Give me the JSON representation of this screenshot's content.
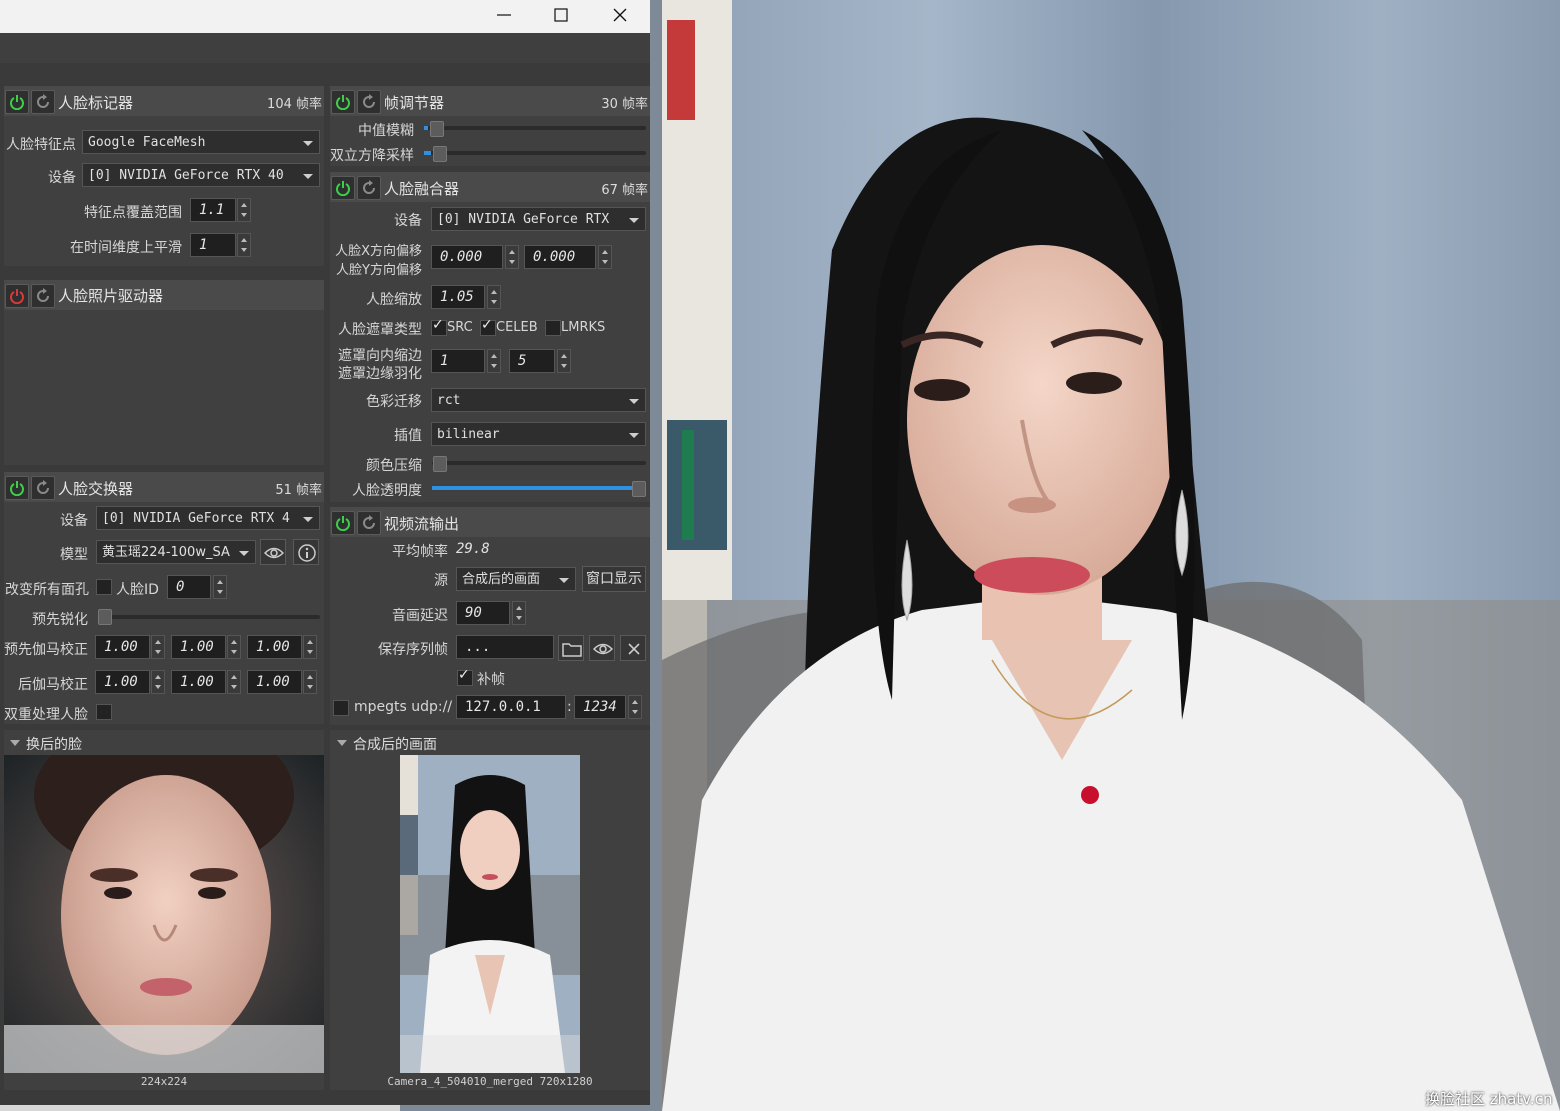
{
  "window": {
    "minimize_icon": "minimize-icon",
    "maximize_icon": "maximize-icon",
    "close_icon": "close-icon"
  },
  "landmarker": {
    "title": "人脸标记器",
    "fps": "104 帧率",
    "landmarks_label": "人脸特征点",
    "landmarks_value": "Google FaceMesh",
    "device_label": "设备",
    "device_value": "[0] NVIDIA GeForce RTX 40",
    "range_label": "特征点覆盖范围",
    "range_value": "1.1",
    "smooth_label": "在时间维度上平滑",
    "smooth_value": "1"
  },
  "animator": {
    "title": "人脸照片驱动器"
  },
  "swapper": {
    "title": "人脸交换器",
    "fps": "51 帧率",
    "device_label": "设备",
    "device_value": "[0] NVIDIA GeForce RTX 4",
    "model_label": "模型",
    "model_value": "黄玉瑶224-100w_SA",
    "swap_all_label": "改变所有面孔",
    "face_id_label": "人脸ID",
    "face_id_value": "0",
    "presharpen_label": "预先锐化",
    "pregamma_label": "预先伽马校正",
    "pregamma_values": [
      "1.00",
      "1.00",
      "1.00"
    ],
    "postgamma_label": "后伽马校正",
    "postgamma_values": [
      "1.00",
      "1.00",
      "1.00"
    ],
    "twopass_label": "双重处理人脸"
  },
  "frame_adjuster": {
    "title": "帧调节器",
    "fps": "30 帧率",
    "median_label": "中值模糊",
    "median_level": 0.02,
    "bicubic_label": "双立方降采样",
    "bicubic_level": 0.03
  },
  "merger": {
    "title": "人脸融合器",
    "fps": "67 帧率",
    "device_label": "设备",
    "device_value": "[0] NVIDIA GeForce RTX",
    "xoffset_label": "人脸X方向偏移",
    "yoffset_label": "人脸Y方向偏移",
    "xoffset_value": "0.000",
    "yoffset_value": "0.000",
    "scale_label": "人脸缩放",
    "scale_value": "1.05",
    "mask_label": "人脸遮罩类型",
    "mask_src": "SRC",
    "mask_celeb": "CELEB",
    "mask_lmrks": "LMRKS",
    "erode_label": "遮罩向内缩边",
    "blur_label": "遮罩边缘羽化",
    "erode_value": "1",
    "blur_value": "5",
    "color_label": "色彩迁移",
    "color_value": "rct",
    "interp_label": "插值",
    "interp_value": "bilinear",
    "compress_label": "颜色压缩",
    "compress_level": 0.0,
    "opacity_label": "人脸透明度",
    "opacity_level": 1.0
  },
  "stream_output": {
    "title": "视频流输出",
    "avg_fps_label": "平均帧率",
    "avg_fps_value": "29.8",
    "source_label": "源",
    "source_value": "合成后的画面",
    "window_button": "窗口显示",
    "delay_label": "音画延迟",
    "delay_value": "90",
    "save_label": "保存序列帧",
    "save_value": "...",
    "fill_label": "补帧",
    "mpegts_label": "mpegts udp://",
    "ip_value": "127.0.0.1",
    "colon": ":",
    "port_value": "1234"
  },
  "previews": {
    "swapped_title": "换后的脸",
    "swapped_caption": "224x224",
    "merged_title": "合成后的画面",
    "merged_caption": "Camera_4_504010_merged 720x1280"
  },
  "watermark": "换脸社区 zhatv.cn",
  "colors": {
    "power_on": "#3ccf4a",
    "power_off": "#d83a3a",
    "slider_accent": "#2f8fe0"
  }
}
